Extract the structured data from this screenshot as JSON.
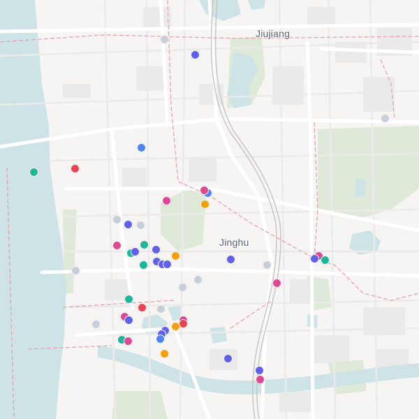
{
  "map": {
    "labels": {
      "city_north": "Jiujiang",
      "district_center": "Jinghu"
    },
    "colors": {
      "land": "#f6f5f4",
      "water": "#cde3e6",
      "park": "#dfe9d9",
      "road_major": "#ffffff",
      "road_minor": "#eceae8",
      "boundary": "#e3a3ad",
      "rail": "#c9c6c3",
      "block": "#ebeaea"
    },
    "marker_palette": {
      "blue": "#4f84ee",
      "indigo": "#6061e8",
      "teal": "#1bb897",
      "pink": "#df4794",
      "red": "#e64450",
      "orange": "#f29f0f",
      "gray": "#c7ced8"
    }
  },
  "points": [
    {
      "color": "gray"
    },
    {
      "color": "indigo"
    },
    {
      "color": "gray"
    },
    {
      "color": "blue"
    },
    {
      "color": "teal"
    },
    {
      "color": "red"
    },
    {
      "color": "pink"
    },
    {
      "color": "blue"
    },
    {
      "color": "pink"
    },
    {
      "color": "orange"
    },
    {
      "color": "gray"
    },
    {
      "color": "indigo"
    },
    {
      "color": "gray"
    },
    {
      "color": "pink"
    },
    {
      "color": "teal"
    },
    {
      "color": "indigo"
    },
    {
      "color": "teal"
    },
    {
      "color": "indigo"
    },
    {
      "color": "orange"
    },
    {
      "color": "teal"
    },
    {
      "color": "indigo"
    },
    {
      "color": "indigo"
    },
    {
      "color": "indigo"
    },
    {
      "color": "indigo"
    },
    {
      "color": "gray"
    },
    {
      "color": "gray"
    },
    {
      "color": "pink"
    },
    {
      "color": "gray"
    },
    {
      "color": "gray"
    },
    {
      "color": "teal"
    },
    {
      "color": "red"
    },
    {
      "color": "gray"
    },
    {
      "color": "pink"
    },
    {
      "color": "indigo"
    },
    {
      "color": "gray"
    },
    {
      "color": "pink"
    },
    {
      "color": "red"
    },
    {
      "color": "indigo"
    },
    {
      "color": "indigo"
    },
    {
      "color": "blue"
    },
    {
      "color": "orange"
    },
    {
      "color": "teal"
    },
    {
      "color": "pink"
    },
    {
      "color": "orange"
    },
    {
      "color": "indigo"
    },
    {
      "color": "indigo"
    },
    {
      "color": "pink"
    },
    {
      "color": "pink"
    },
    {
      "color": "indigo"
    },
    {
      "color": "teal"
    }
  ]
}
